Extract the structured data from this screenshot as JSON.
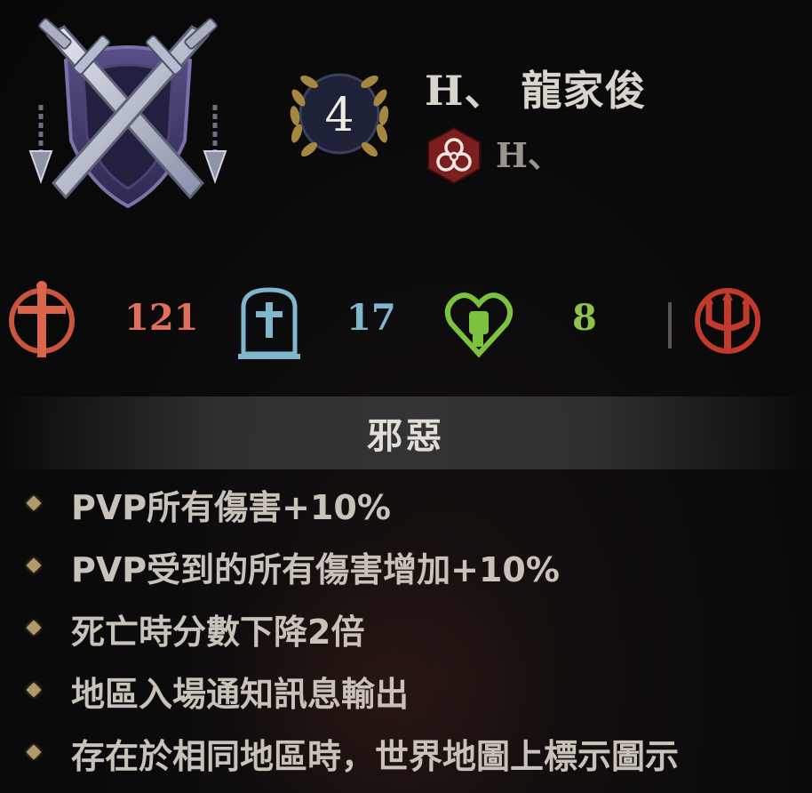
{
  "header": {
    "level": "4",
    "player_name": "H、 龍家俊",
    "guild_name": "H、",
    "emblem_icon": "crossed-swords-shield-icon",
    "guild_icon": "biohazard-icon"
  },
  "stats": [
    {
      "icon": "dagger-cross-icon",
      "value": "121",
      "color": "#e0705e"
    },
    {
      "icon": "tombstone-icon",
      "value": "17",
      "color": "#7fb8cc"
    },
    {
      "icon": "heart-fist-icon",
      "value": "8",
      "color": "#8ec24a"
    },
    {
      "icon": "trident-icon",
      "color": "#c23a2c"
    }
  ],
  "status": {
    "title": "邪惡",
    "effects": [
      "PVP所有傷害+10%",
      "PVP受到的所有傷害增加+10%",
      "死亡時分數下降2倍",
      "地區入場通知訊息輸出",
      "存在於相同地區時，世界地圖上標示圖示"
    ]
  }
}
